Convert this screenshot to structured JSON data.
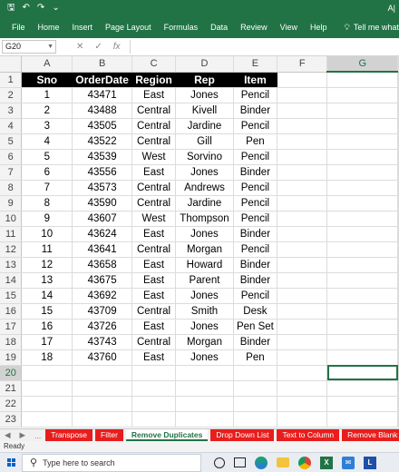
{
  "titlebar": {
    "autosave_icon": "save-icon",
    "undo_icon": "undo-icon",
    "redo_icon": "redo-icon",
    "right_text": "A|"
  },
  "ribbon": {
    "tabs": [
      "File",
      "Home",
      "Insert",
      "Page Layout",
      "Formulas",
      "Data",
      "Review",
      "View",
      "Help"
    ],
    "tell_me": "Tell me what you want to do",
    "tell_icon": "lightbulb-icon"
  },
  "formula_bar": {
    "name_box": "G20",
    "cancel": "✕",
    "enter": "✓",
    "fx": "fx",
    "value": ""
  },
  "grid": {
    "columns": [
      "A",
      "B",
      "C",
      "D",
      "E",
      "F",
      "G"
    ],
    "selected_column": "G",
    "selected_row": 20,
    "headers": [
      "Sno",
      "OrderDate",
      "Region",
      "Rep",
      "Item"
    ],
    "rows": [
      [
        "1",
        "43471",
        "East",
        "Jones",
        "Pencil"
      ],
      [
        "2",
        "43488",
        "Central",
        "Kivell",
        "Binder"
      ],
      [
        "3",
        "43505",
        "Central",
        "Jardine",
        "Pencil"
      ],
      [
        "4",
        "43522",
        "Central",
        "Gill",
        "Pen"
      ],
      [
        "5",
        "43539",
        "West",
        "Sorvino",
        "Pencil"
      ],
      [
        "6",
        "43556",
        "East",
        "Jones",
        "Binder"
      ],
      [
        "7",
        "43573",
        "Central",
        "Andrews",
        "Pencil"
      ],
      [
        "8",
        "43590",
        "Central",
        "Jardine",
        "Pencil"
      ],
      [
        "9",
        "43607",
        "West",
        "Thompson",
        "Pencil"
      ],
      [
        "10",
        "43624",
        "East",
        "Jones",
        "Binder"
      ],
      [
        "11",
        "43641",
        "Central",
        "Morgan",
        "Pencil"
      ],
      [
        "12",
        "43658",
        "East",
        "Howard",
        "Binder"
      ],
      [
        "13",
        "43675",
        "East",
        "Parent",
        "Binder"
      ],
      [
        "14",
        "43692",
        "East",
        "Jones",
        "Pencil"
      ],
      [
        "15",
        "43709",
        "Central",
        "Smith",
        "Desk"
      ],
      [
        "16",
        "43726",
        "East",
        "Jones",
        "Pen Set"
      ],
      [
        "17",
        "43743",
        "Central",
        "Morgan",
        "Binder"
      ],
      [
        "18",
        "43760",
        "East",
        "Jones",
        "Pen"
      ]
    ],
    "total_rows": 23
  },
  "sheet_tabs": {
    "nav_prev": "◀",
    "nav_next": "▶",
    "more": "...",
    "tabs": [
      "Transpose",
      "Filter",
      "Remove Duplicates",
      "Drop Down List",
      "Text to Column",
      "Remove Blank Cells"
    ],
    "active": "Remove Duplicates"
  },
  "status": {
    "text": "Ready"
  },
  "taskbar": {
    "search_placeholder": "Type here to search",
    "icons": [
      "windows-start-icon",
      "search-icon",
      "task-view-icon",
      "widgets-icon",
      "edge-icon",
      "file-explorer-icon",
      "chrome-icon",
      "excel-icon",
      "chat-icon",
      "app-l-icon"
    ],
    "excel_letter": "X",
    "l_letter": "L"
  },
  "colors": {
    "excel_green": "#217346",
    "tab_red": "#e81e1e",
    "header_black": "#000000"
  }
}
